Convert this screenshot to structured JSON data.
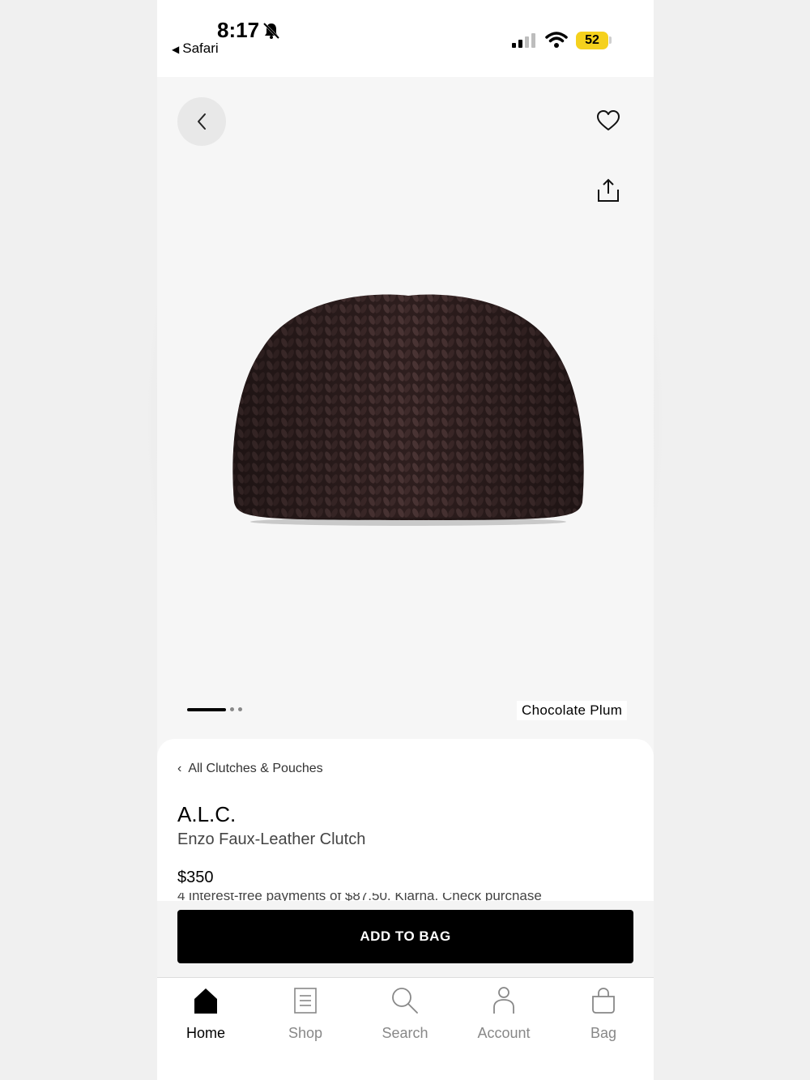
{
  "status_bar": {
    "time": "8:17",
    "back_app": "Safari",
    "battery": "52"
  },
  "hero": {
    "color_name": "Chocolate Plum",
    "image_count": 3,
    "active_image": 1
  },
  "product": {
    "breadcrumb": "All Clutches & Pouches",
    "brand": "A.L.C.",
    "name": "Enzo Faux-Leather Clutch",
    "price": "$350",
    "installment_text": "4 interest-free payments of $87.50. Klarna. Check purchase"
  },
  "cta": {
    "add_to_bag": "ADD TO BAG"
  },
  "tabs": [
    {
      "label": "Home",
      "icon": "home-icon",
      "active": true
    },
    {
      "label": "Shop",
      "icon": "shop-icon",
      "active": false
    },
    {
      "label": "Search",
      "icon": "search-icon",
      "active": false
    },
    {
      "label": "Account",
      "icon": "account-icon",
      "active": false
    },
    {
      "label": "Bag",
      "icon": "bag-icon",
      "active": false
    }
  ],
  "colors": {
    "battery": "#f5d11d",
    "product": "#2e1e1e",
    "cta_bg": "#000000"
  }
}
